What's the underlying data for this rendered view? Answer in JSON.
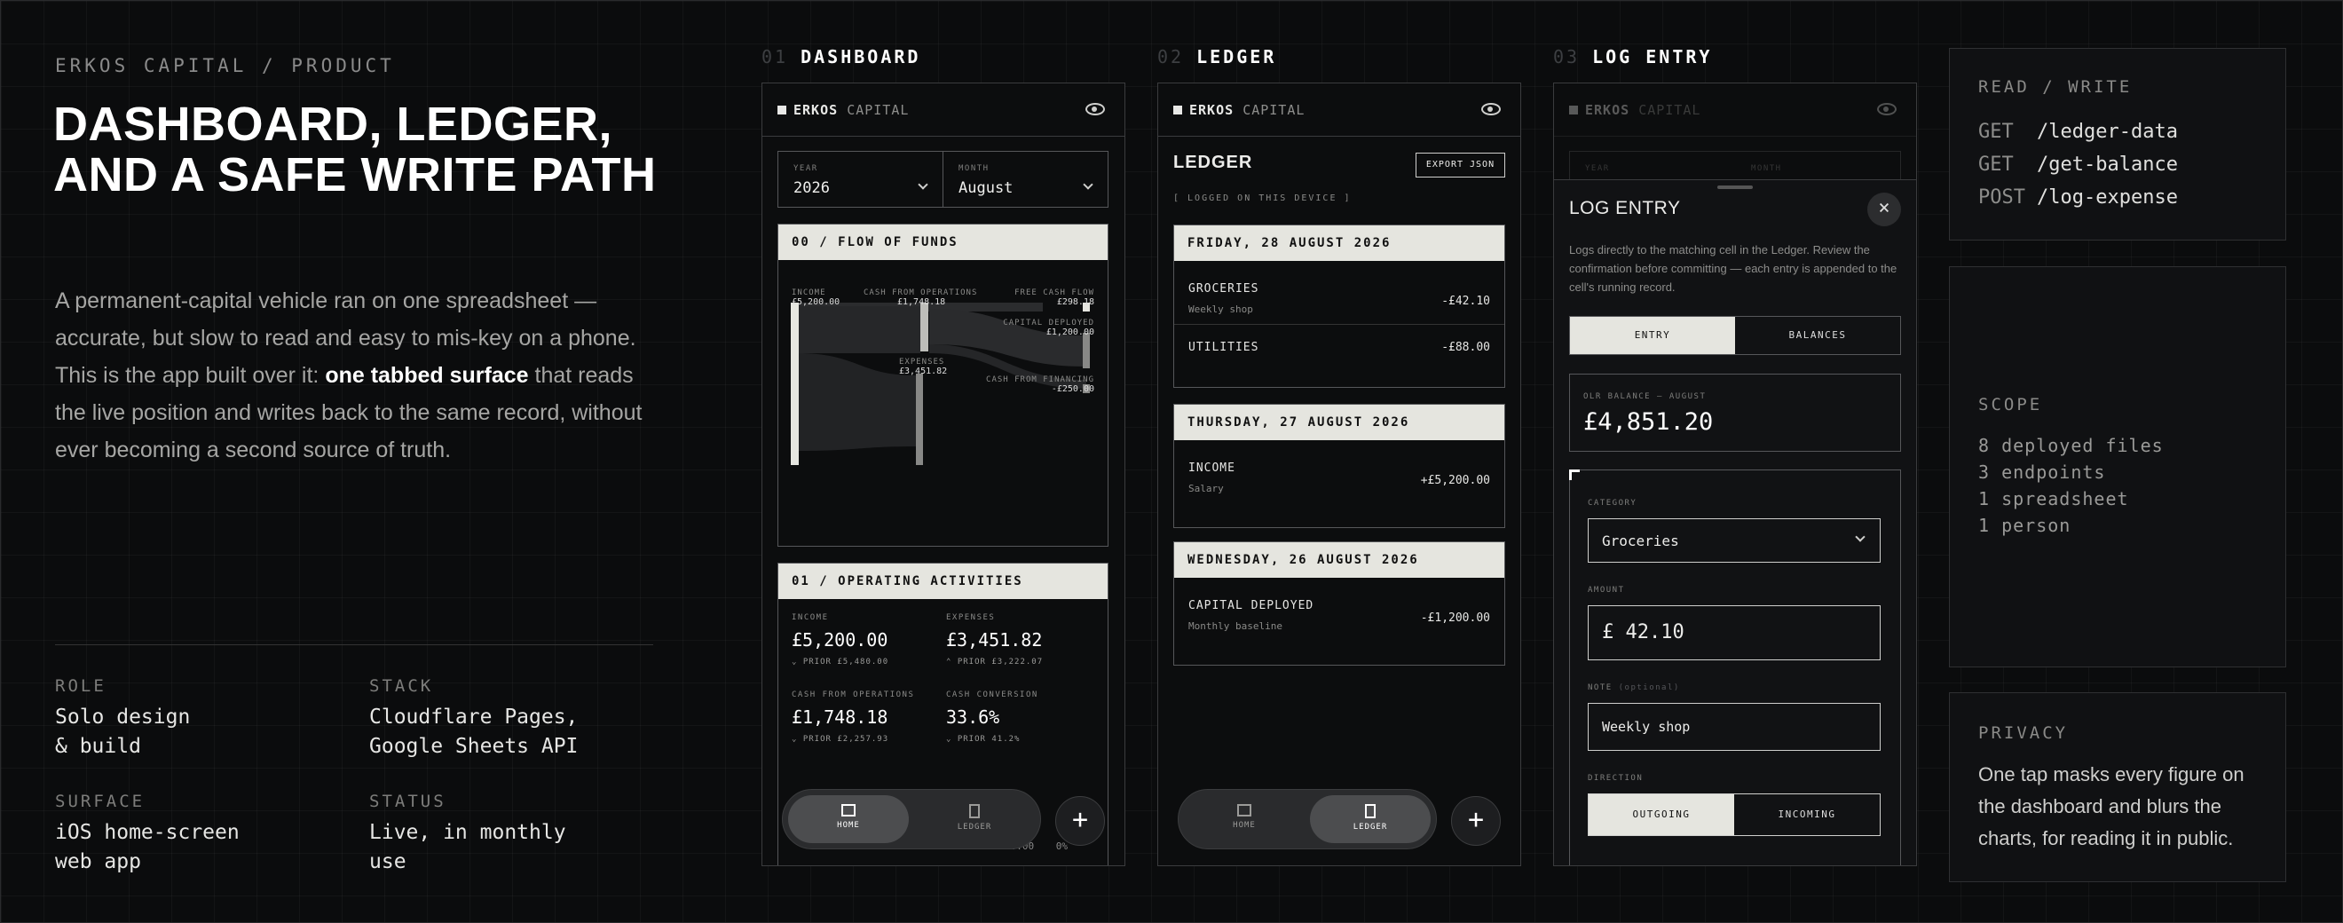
{
  "header": {
    "eyebrow": "ERKOS CAPITAL / PRODUCT",
    "headline": "DASHBOARD, LEDGER, AND A SAFE WRITE PATH",
    "intro_a": "A permanent-capital vehicle ran on one spreadsheet — accurate, but slow to read and easy to mis-key on a phone. This is the app built over it: ",
    "intro_bold": "one tabbed surface",
    "intro_b": " that reads the live position and writes back to the same record, without ever becoming a second source of truth."
  },
  "meta": {
    "role_k": "ROLE",
    "role_v": "Solo design\n& build",
    "stack_k": "STACK",
    "stack_v": "Cloudflare Pages,\nGoogle Sheets API",
    "surface_k": "SURFACE",
    "surface_v": "iOS home-screen\nweb app",
    "status_k": "STATUS",
    "status_v": "Live, in monthly\nuse"
  },
  "phones": {
    "p1": {
      "num": "01",
      "title": "DASHBOARD"
    },
    "p2": {
      "num": "02",
      "title": "LEDGER"
    },
    "p3": {
      "num": "03",
      "title": "LOG ENTRY"
    },
    "brand_a": "ERKOS",
    "brand_b": "CAPITAL"
  },
  "dashboard": {
    "year_lbl": "YEAR",
    "year": "2026",
    "month_lbl": "MONTH",
    "month": "August",
    "flow_title": "00 / FLOW OF FUNDS",
    "flow": {
      "income_lbl": "INCOME",
      "income": "£5,200.00",
      "cfo_lbl": "CASH FROM OPERATIONS",
      "cfo": "£1,748.18",
      "fcf_lbl": "FREE CASH FLOW",
      "fcf": "£298.18",
      "cap_lbl": "CAPITAL DEPLOYED",
      "cap": "£1,200.00",
      "exp_lbl": "EXPENSES",
      "exp": "£3,451.82",
      "fin_lbl": "CASH FROM FINANCING",
      "fin": "-£250.00"
    },
    "ops_title": "01 / OPERATING ACTIVITIES",
    "ops": [
      {
        "label": "INCOME",
        "value": "£5,200.00",
        "prior": "PRIOR £5,480.00",
        "dir": "down"
      },
      {
        "label": "EXPENSES",
        "value": "£3,451.82",
        "prior": "PRIOR £3,222.07",
        "dir": "up"
      },
      {
        "label": "CASH FROM OPERATIONS",
        "value": "£1,748.18",
        "prior": "PRIOR £2,257.93",
        "dir": "down"
      },
      {
        "label": "CASH CONVERSION",
        "value": "33.6%",
        "prior": "PRIOR 41.2%",
        "dir": "down"
      }
    ],
    "peek": "£0.00",
    "peek_pct": "0%"
  },
  "tabs": {
    "home": "HOME",
    "ledger": "LEDGER",
    "plus": "+"
  },
  "ledger": {
    "title": "LEDGER",
    "export": "EXPORT JSON",
    "note": "[ LOGGED ON THIS DEVICE ]",
    "days": [
      {
        "date": "FRIDAY, 28 AUGUST 2026",
        "rows": [
          {
            "name": "GROCERIES",
            "sub": "Weekly shop",
            "amt": "-£42.10"
          },
          {
            "name": "UTILITIES",
            "sub": "",
            "amt": "-£88.00"
          }
        ]
      },
      {
        "date": "THURSDAY, 27 AUGUST 2026",
        "rows": [
          {
            "name": "INCOME",
            "sub": "Salary",
            "amt": "+£5,200.00"
          }
        ]
      },
      {
        "date": "WEDNESDAY, 26 AUGUST 2026",
        "rows": [
          {
            "name": "CAPITAL DEPLOYED",
            "sub": "Monthly baseline",
            "amt": "-£1,200.00"
          }
        ]
      }
    ]
  },
  "logentry": {
    "title": "LOG ENTRY",
    "close": "×",
    "desc": "Logs directly to the matching cell in the Ledger. Review the confirmation before committing — each entry is appended to the cell's running record.",
    "seg_a": "ENTRY",
    "seg_b": "BALANCES",
    "bal_lbl": "OLR BALANCE — AUGUST",
    "bal": "£4,851.20",
    "cat_lbl": "CATEGORY",
    "cat": "Groceries",
    "amt_lbl": "AMOUNT",
    "amt": "£ 42.10",
    "note_lbl": "NOTE",
    "note_opt": "(optional)",
    "note": "Weekly shop",
    "dir_lbl": "DIRECTION",
    "out": "OUTGOING",
    "inc": "INCOMING",
    "bg_year": "YEAR",
    "bg_month": "MONTH"
  },
  "panels": {
    "rw_k": "READ / WRITE",
    "api": [
      {
        "m": "GET",
        "p": "/ledger-data"
      },
      {
        "m": "GET",
        "p": "/get-balance"
      },
      {
        "m": "POST",
        "p": "/log-expense"
      }
    ],
    "scope_k": "SCOPE",
    "scope": [
      "8 deployed files",
      "3 endpoints",
      "1 spreadsheet",
      "1 person"
    ],
    "priv_k": "PRIVACY",
    "priv": "One tap masks every figure on the dashboard and blurs the charts, for reading it in public."
  }
}
